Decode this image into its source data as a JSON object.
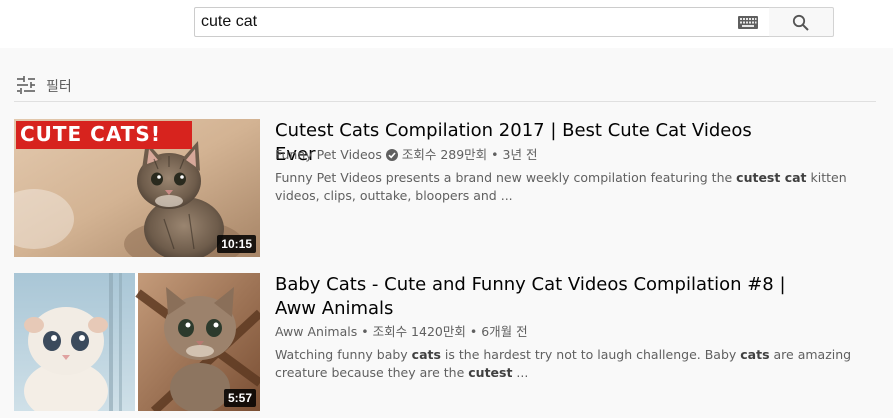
{
  "search": {
    "query": "cute cat",
    "keyboard_icon": "keyboard-icon",
    "button_icon": "search-icon"
  },
  "filter": {
    "label": "필터",
    "icon": "sliders-icon"
  },
  "results": [
    {
      "title": "Cutest Cats Compilation 2017 | Best Cute Cat Videos Ever",
      "channel": "Funny Pet Videos",
      "verified": true,
      "views": "조회수 289만회",
      "age": "3년 전",
      "separator": "•",
      "description": {
        "before": "Funny Pet Videos presents a brand new weekly compilation featuring the ",
        "bold": "cutest cat",
        "after": " kitten videos, clips, outtake, bloopers and ..."
      },
      "duration": "10:15",
      "thumb_caption": "CUTE CATS!"
    },
    {
      "title": "Baby Cats - Cute and Funny Cat Videos Compilation #8 | Aww Animals",
      "channel": "Aww Animals",
      "verified": false,
      "views": "조회수 1420만회",
      "age": "6개월 전",
      "separator": "•",
      "description": {
        "p1": "Watching funny baby ",
        "b1": "cats",
        "p2": " is the hardest try not to laugh challenge. Baby ",
        "b2": "cats",
        "p3": " are amazing creature because they are the ",
        "b3": "cutest",
        "p4": " ..."
      },
      "duration": "5:57"
    }
  ],
  "colors": {
    "caption_red": "#d7231e",
    "text_primary": "#030303",
    "text_secondary": "#606060"
  }
}
